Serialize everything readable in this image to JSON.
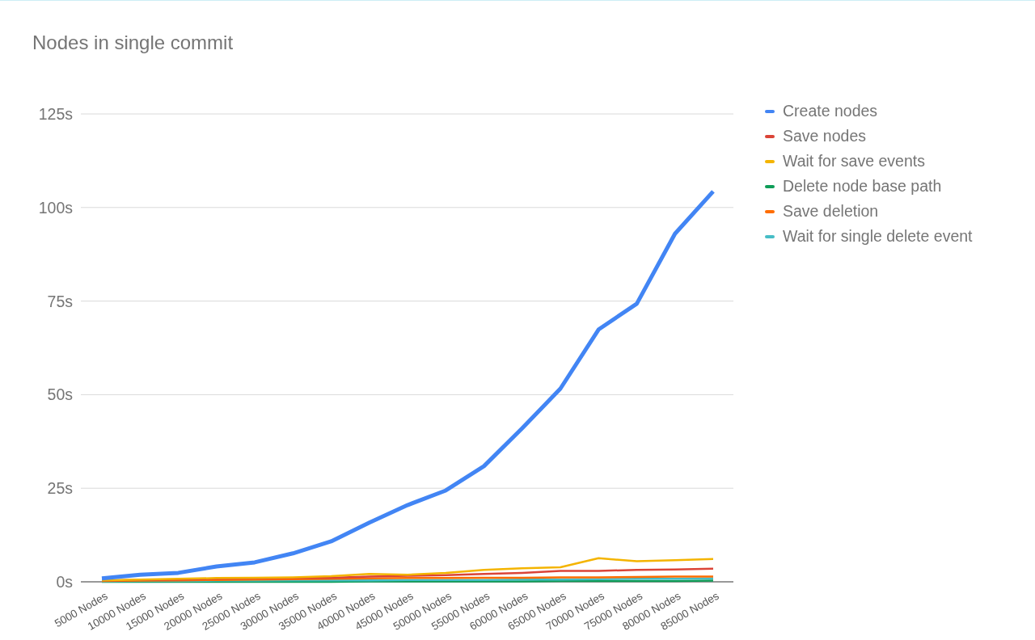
{
  "chart_data": {
    "type": "line",
    "title": "Nodes in single commit",
    "grid": true,
    "categories": [
      "5000 Nodes",
      "10000 Nodes",
      "15000 Nodes",
      "20000 Nodes",
      "25000 Nodes",
      "30000 Nodes",
      "35000 Nodes",
      "40000 Nodes",
      "45000 Nodes",
      "50000 Nodes",
      "55000 Nodes",
      "60000 Nodes",
      "65000 Nodes",
      "70000 Nodes",
      "75000 Nodes",
      "80000 Nodes",
      "85000 Nodes"
    ],
    "ylim": [
      0,
      125
    ],
    "yticks": [
      {
        "value": 0,
        "label": "0s"
      },
      {
        "value": 25,
        "label": "25s"
      },
      {
        "value": 50,
        "label": "50s"
      },
      {
        "value": 75,
        "label": "75s"
      },
      {
        "value": 100,
        "label": "100s"
      },
      {
        "value": 125,
        "label": "125s"
      }
    ],
    "series": [
      {
        "name": "Create nodes",
        "color": "#4285f4",
        "values": [
          0.9,
          1.9,
          2.4,
          4.1,
          5.2,
          7.6,
          10.8,
          15.8,
          20.5,
          24.4,
          30.9,
          41,
          51.6,
          67.4,
          74.3,
          93,
          104.3
        ]
      },
      {
        "name": "Save nodes",
        "color": "#db4437",
        "values": [
          0.3,
          0.5,
          0.6,
          0.8,
          0.9,
          1,
          1.1,
          1.4,
          1.6,
          1.8,
          2.1,
          2.4,
          2.9,
          2.9,
          3.2,
          3.3,
          3.5
        ]
      },
      {
        "name": "Wait for save events",
        "color": "#f4b400",
        "values": [
          0.4,
          0.6,
          0.8,
          1,
          1.1,
          1.2,
          1.5,
          2.1,
          1.9,
          2.4,
          3.2,
          3.6,
          3.9,
          6.3,
          5.5,
          5.8,
          6.1
        ]
      },
      {
        "name": "Delete node base path",
        "color": "#0f9d58",
        "values": [
          0,
          0,
          0,
          0,
          0,
          0,
          0,
          0.1,
          0.1,
          0.1,
          0.1,
          0.1,
          0.2,
          0.2,
          0.2,
          0.2,
          0.3
        ]
      },
      {
        "name": "Save deletion",
        "color": "#ff6d00",
        "values": [
          0.2,
          0.3,
          0.4,
          0.5,
          0.6,
          0.7,
          0.8,
          0.9,
          1,
          1,
          1.1,
          1.1,
          1.2,
          1.2,
          1.3,
          1.4,
          1.4
        ]
      },
      {
        "name": "Wait for single delete event",
        "color": "#46bdc6",
        "values": [
          0.1,
          0.2,
          0.2,
          0.3,
          0.3,
          0.4,
          0.4,
          0.4,
          0.5,
          0.5,
          0.5,
          0.6,
          0.6,
          0.7,
          0.8,
          0.8,
          0.9
        ]
      }
    ]
  }
}
